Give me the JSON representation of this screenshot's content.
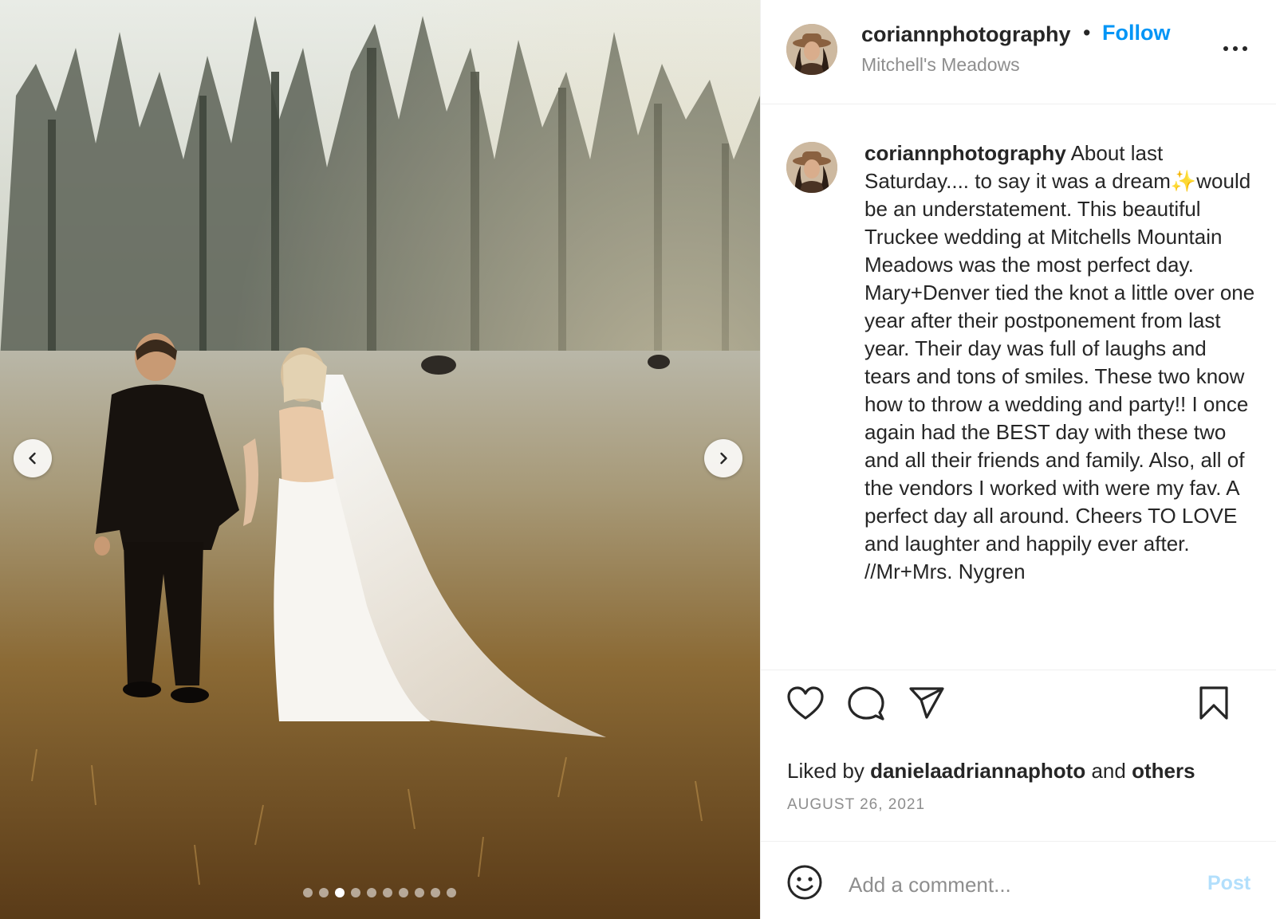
{
  "post": {
    "username": "coriannphotography",
    "separator": "•",
    "follow_label": "Follow",
    "location": "Mitchell's Meadows",
    "caption_text": "About last Saturday.... to say it was a dream✨would be an understatement. This beautiful Truckee wedding at Mitchells Mountain Meadows was the most perfect day. Mary+Denver tied the knot a little over one year after their postponement from last year. Their day was full of laughs and tears and tons of smiles. These two know how to throw a wedding and party!! I once again had the BEST day with these two and all their friends and family. Also, all of the vendors I worked with were my fav. A perfect day all around. Cheers TO LOVE and laughter and happily ever after. //Mr+Mrs. Nygren",
    "liked_by_prefix": "Liked by",
    "liked_by_user": "danielaadriannaphoto",
    "liked_by_and": "and",
    "liked_by_others": "others",
    "date": "AUGUST 26, 2021"
  },
  "carousel": {
    "dot_count": 10,
    "active_index": 2
  },
  "icons": {
    "prev": "chevron-left-icon",
    "next": "chevron-right-icon",
    "more": "more-options-icon",
    "like": "heart-icon",
    "comment": "comment-icon",
    "share": "send-icon",
    "save": "bookmark-icon",
    "emoji": "emoji-icon"
  },
  "comment": {
    "placeholder": "Add a comment...",
    "post_label": "Post"
  },
  "colors": {
    "accent": "#0095f6",
    "post_disabled": "#b2dffc",
    "muted": "#8e8e8e"
  }
}
